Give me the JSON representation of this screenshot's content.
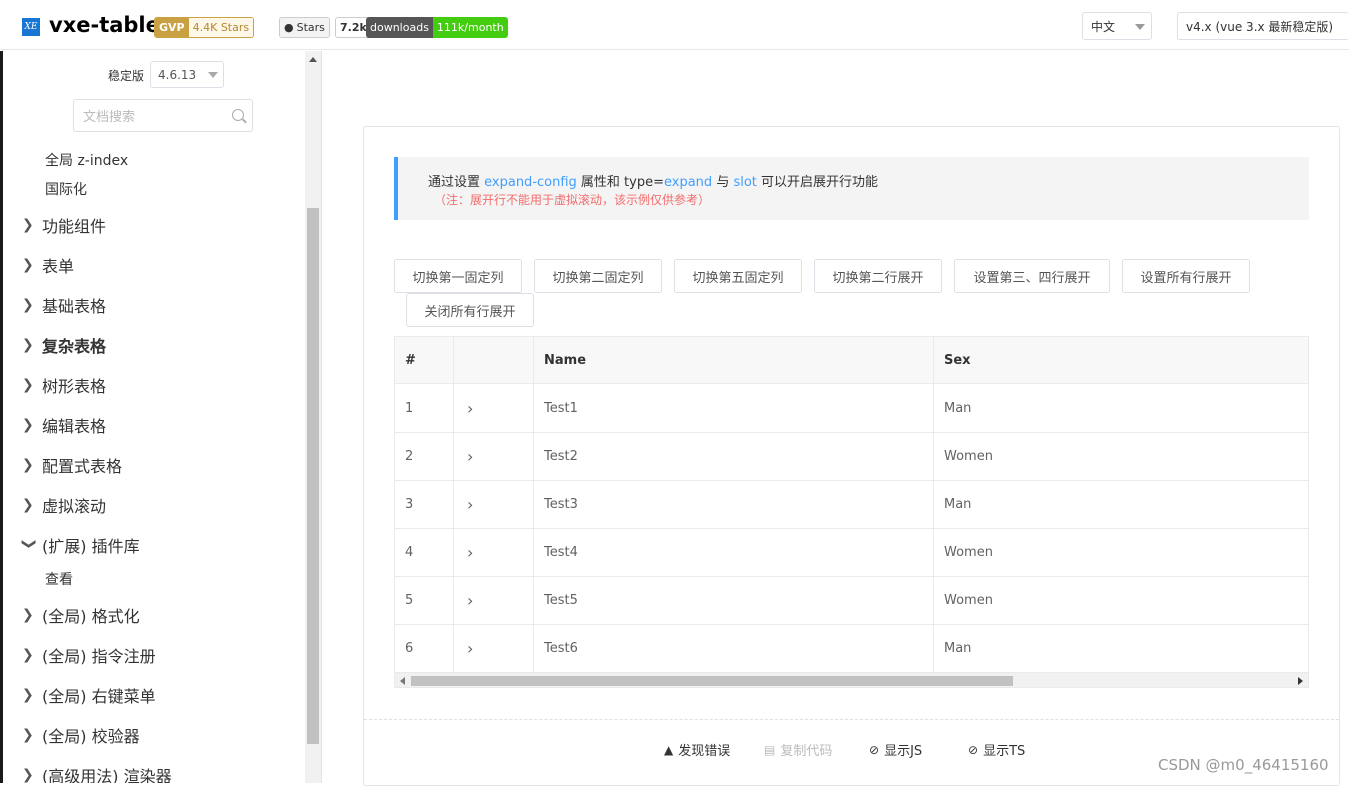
{
  "header": {
    "logo_text": "XE",
    "brand": "vxe-table",
    "badges": {
      "gvp_left": "GVP",
      "gvp_right": "4.4K Stars",
      "github_left": "Stars",
      "github_count": "7.2k",
      "downloads_left": "downloads",
      "downloads_right": "111k/month"
    },
    "lang_select": "中文",
    "version_select": "v4.x (vue 3.x 最新稳定版)"
  },
  "sidebar": {
    "version_label": "稳定版",
    "version_value": "4.6.13",
    "search_placeholder": "文档搜索",
    "sub_top": [
      "全局 z-index",
      "国际化"
    ],
    "items": [
      {
        "label": "功能组件",
        "expanded": false
      },
      {
        "label": "表单",
        "expanded": false
      },
      {
        "label": "基础表格",
        "expanded": false
      },
      {
        "label": "复杂表格",
        "expanded": false,
        "active": true
      },
      {
        "label": "树形表格",
        "expanded": false
      },
      {
        "label": "编辑表格",
        "expanded": false
      },
      {
        "label": "配置式表格",
        "expanded": false
      },
      {
        "label": "虚拟滚动",
        "expanded": false
      },
      {
        "label": "(扩展) 插件库",
        "expanded": true
      },
      {
        "label": "(全局) 格式化",
        "expanded": false
      },
      {
        "label": "(全局) 指令注册",
        "expanded": false
      },
      {
        "label": "(全局) 右键菜单",
        "expanded": false
      },
      {
        "label": "(全局) 校验器",
        "expanded": false
      },
      {
        "label": "(高级用法) 渲染器",
        "expanded": false
      }
    ],
    "plugin_sub": "查看"
  },
  "tip": {
    "p1": "通过设置 ",
    "kw1": "expand-config",
    "p2": " 属性和 type=",
    "kw2": "expand",
    "p3": " 与 ",
    "kw3": "slot",
    "p4": " 可以开启展开行功能",
    "note": "（注：展开行不能用于虚拟滚动，该示例仅供参考）"
  },
  "buttons": [
    "切换第一固定列",
    "切换第二固定列",
    "切换第五固定列",
    "切换第二行展开",
    "设置第三、四行展开",
    "设置所有行展开",
    "关闭所有行展开"
  ],
  "table": {
    "headers": [
      "#",
      "",
      "Name",
      "Sex"
    ],
    "rows": [
      {
        "seq": "1",
        "name": "Test1",
        "sex": "Man"
      },
      {
        "seq": "2",
        "name": "Test2",
        "sex": "Women"
      },
      {
        "seq": "3",
        "name": "Test3",
        "sex": "Man"
      },
      {
        "seq": "4",
        "name": "Test4",
        "sex": "Women"
      },
      {
        "seq": "5",
        "name": "Test5",
        "sex": "Women"
      },
      {
        "seq": "6",
        "name": "Test6",
        "sex": "Man"
      }
    ]
  },
  "footer": {
    "report": "发现错误",
    "copy": "复制代码",
    "show_js": "显示JS",
    "show_ts": "显示TS"
  },
  "watermark": "CSDN @m0_46415160",
  "colors": {
    "accent": "#409eff",
    "warning_text": "#f56c6c",
    "gvp": "#c9a042",
    "downloads": "#44cc11"
  }
}
